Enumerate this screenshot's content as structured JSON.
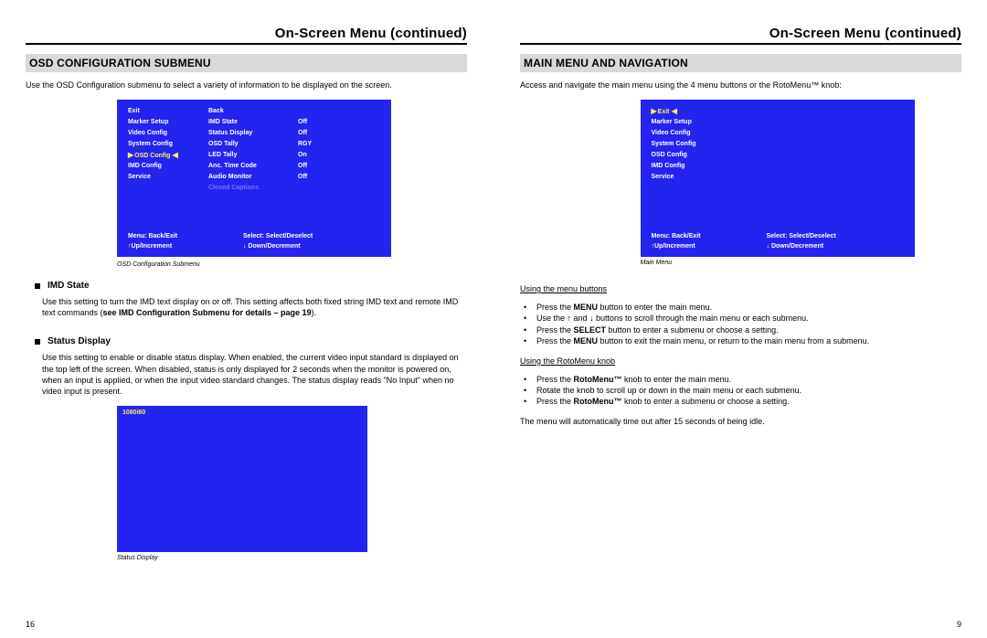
{
  "left": {
    "header": "On-Screen Menu (continued)",
    "section": "OSD CONFIGURATION SUBMENU",
    "intro": "Use the OSD Configuration submenu to select a variety of information to be displayed on the screen.",
    "osd": {
      "rows": [
        {
          "c1": "Exit",
          "c2": "Back",
          "c3": ""
        },
        {
          "c1": "Marker Setup",
          "c2": "IMD State",
          "c3": "Off"
        },
        {
          "c1": "Video Config",
          "c2": "Status Display",
          "c3": "Off"
        },
        {
          "c1": "System Config",
          "c2": "OSD Tally",
          "c3": "RGY"
        },
        {
          "c1": "OSD Config",
          "c2": "LED Tally",
          "c3": "On",
          "hl": true
        },
        {
          "c1": "IMD Config",
          "c2": "Anc. Time Code",
          "c3": "Off"
        },
        {
          "c1": "Service",
          "c2": "Audio Monitor",
          "c3": "Off"
        }
      ],
      "closed_cap": "Closed Captions",
      "foot": {
        "a1": "Menu: Back/Exit",
        "a2": "Select: Select/Deselect",
        "b1": "↑Up/Increment",
        "b2": "↓ Down/Decrement"
      },
      "caption": "OSD Configuration Submenu"
    },
    "imd": {
      "title": "IMD State",
      "text_a": "Use this setting to turn the IMD text display on or off. This setting affects both fixed string IMD text and remote IMD text commands (",
      "text_b": "see IMD Configuration Submenu for details – page 19",
      "text_c": ")."
    },
    "status": {
      "title": "Status Display",
      "text": "Use this setting to enable or disable status display. When enabled, the current video input standard is displayed on the top left of the screen. When disabled, status is only displayed for 2 seconds when the monitor is powered on, when an input is applied, or when the input video standard changes. The status display reads \"No Input\" when no video input is present.",
      "badge": "1080i60",
      "caption": "Status Display"
    },
    "pageno": "16"
  },
  "right": {
    "header": "On-Screen Menu (continued)",
    "section": "MAIN MENU AND NAVIGATION",
    "intro": "Access and navigate the main menu using the 4 menu buttons or the RotoMenu™ knob:",
    "osd": {
      "rows": [
        {
          "c1": "Exit",
          "hl": true
        },
        {
          "c1": "Marker Setup"
        },
        {
          "c1": "Video Config"
        },
        {
          "c1": "System Config"
        },
        {
          "c1": "OSD Config"
        },
        {
          "c1": "IMD Config"
        },
        {
          "c1": "Service"
        }
      ],
      "foot": {
        "a1": "Menu: Back/Exit",
        "a2": "Select: Select/Deselect",
        "b1": "↑Up/Increment",
        "b2": "↓ Down/Decrement"
      },
      "caption": "Main Menu"
    },
    "nav1": {
      "title": "Using the menu buttons",
      "items": [
        "Press the <b>MENU</b> button to enter the main menu.",
        "Use the ↑ and ↓ buttons to scroll through the main menu or each submenu.",
        "Press the <b>SELECT</b> button to enter a submenu or choose a setting.",
        "Press the <b>MENU</b> button to exit the main menu, or return to the main menu from a submenu."
      ]
    },
    "nav2": {
      "title": "Using the RotoMenu knob",
      "items": [
        "Press the <b>RotoMenu™</b> knob to enter the main menu.",
        "Rotate the knob to scroll up or down in the main menu or each submenu.",
        "Press the <b>RotoMenu™</b> knob to enter a submenu or choose a setting."
      ]
    },
    "timeout": "The menu will automatically time out after 15 seconds of being idle.",
    "pageno": "9"
  }
}
